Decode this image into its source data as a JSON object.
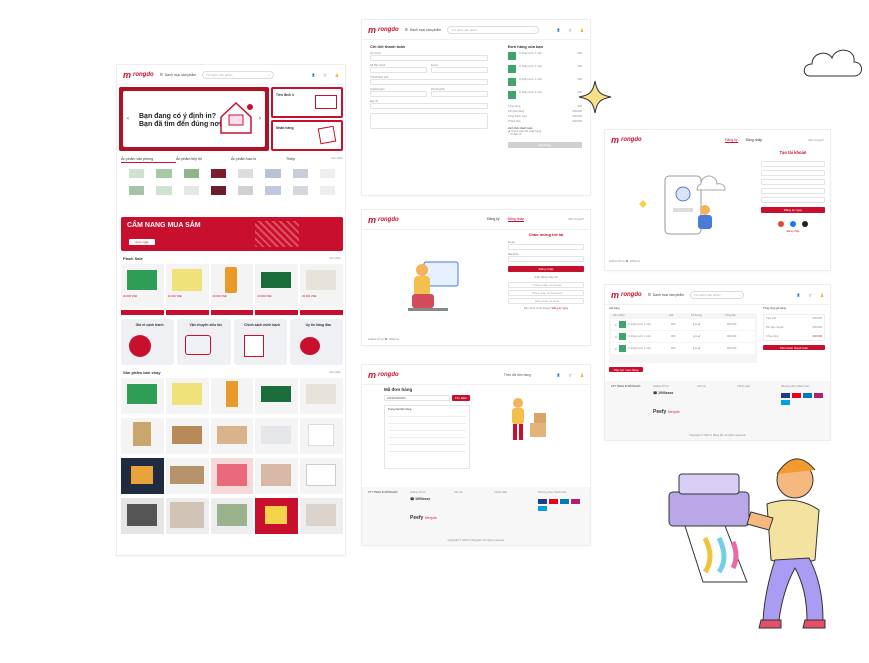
{
  "brand": {
    "logo_text": "rongdo",
    "accent": "#c8102e"
  },
  "header": {
    "category_label": "Danh mục sản phẩm",
    "search_placeholder": "Tìm kiếm sản phẩm",
    "icons": [
      "Tài khoản",
      "Giỏ hàng",
      "Thông báo"
    ]
  },
  "home": {
    "hero_title_line1": "Bạn đang có ý định in?",
    "hero_title_line2": "Bạn đã tìm đến đúng nơi",
    "side_card1": "Tiền lãnh lì",
    "side_card2": "Nhận hàng",
    "categories": [
      "Ấn phẩm văn phòng",
      "Ấn phẩm tiếp thị",
      "Ấn phẩm bao bì",
      "Thiệp"
    ],
    "view_all": "Xem thêm",
    "banner_title": "CẨM NANG MUA SẮM",
    "banner_btn": "Xem ngay",
    "flash_title": "Flash Sale",
    "services": [
      "Giá rẻ cạnh tranh",
      "Vận chuyển siêu tốc",
      "Chính sách minh bạch",
      "Uy tín hàng đầu"
    ],
    "best_title": "Sản phẩm bán chạy",
    "price": "20.000 VNĐ"
  },
  "checkout": {
    "title": "Chi tiết thanh toán",
    "order_title": "Đơn hàng của bạn",
    "fields": [
      "Họ và tên",
      "Số điện thoại",
      "Email",
      "Tỉnh/Thành phố",
      "Quận/Huyện",
      "Phường/Xã",
      "Địa chỉ"
    ],
    "items": [
      "In thiệp cưới, 1 mặt",
      "In thiệp cưới, 1 mặt",
      "In thiệp cưới, 1 mặt",
      "In thiệp cưới, 1 mặt"
    ],
    "item_price": "000",
    "totals": [
      "Tổng cộng",
      "Phí giao hàng",
      "Tổng thanh toán",
      "Thành tiền"
    ],
    "total_value": "000.000",
    "payment_title": "Hình thức thanh toán",
    "payment_opts": [
      "Thanh toán khi nhận hàng",
      "Ví điện tử"
    ],
    "submit": "Đặt hàng"
  },
  "login": {
    "tabs": [
      "Đăng ký",
      "Đăng nhập"
    ],
    "help": "Cần trợ giúp?",
    "welcome": "Chào mừng trở lại",
    "fields": [
      "Email",
      "Mật khẩu"
    ],
    "submit": "Đăng nhập",
    "or": "Hoặc đăng nhập với",
    "socials": [
      "Đăng nhập với Google",
      "Đăng nhập với Facebook",
      "Đăng nhập với Apple"
    ],
    "register_prompt": "Bạn chưa có tài khoản?",
    "register_link": "Đăng ký ngay",
    "hotline_label": "Hotline hỗ trợ",
    "hotline": "1900xxxx"
  },
  "tracking": {
    "header_link": "Theo dõi đơn hàng",
    "title": "Mã đơn hàng",
    "input_value": "2023061500001",
    "btn": "Tìm kiếm",
    "subtitle": "Trạng thái đơn hàng"
  },
  "register": {
    "tabs": [
      "Đăng ký",
      "Đăng nhập"
    ],
    "help": "Cần trợ giúp?",
    "title": "Tạo tài khoản",
    "submit": "Đăng ký ngay",
    "login_link": "Đăng nhập"
  },
  "cart": {
    "title": "Giỏ hàng",
    "columns": [
      "Sản phẩm",
      "Giá",
      "Số lượng",
      "Tổng tiền"
    ],
    "summary_title": "Tổng cộng giỏ hàng",
    "summary_rows": [
      "Tạm tính",
      "Phí vận chuyển",
      "Tổng cộng"
    ],
    "summary_value": "000.000",
    "checkout_btn": "Tiến hành thanh toán",
    "continue_btn": "Tiếp tục mua hàng"
  },
  "footer": {
    "company": "CTY TNHH IN RỒNG ĐỎ",
    "hotline_label": "Hotline hỗ trợ",
    "hotline": "1900xxxx",
    "cols": [
      "Liên hệ",
      "Chính sách",
      "Phương thức thanh toán"
    ],
    "copyright": "Copyright © 2023 In Rồng Đỏ. All rights reserved."
  }
}
